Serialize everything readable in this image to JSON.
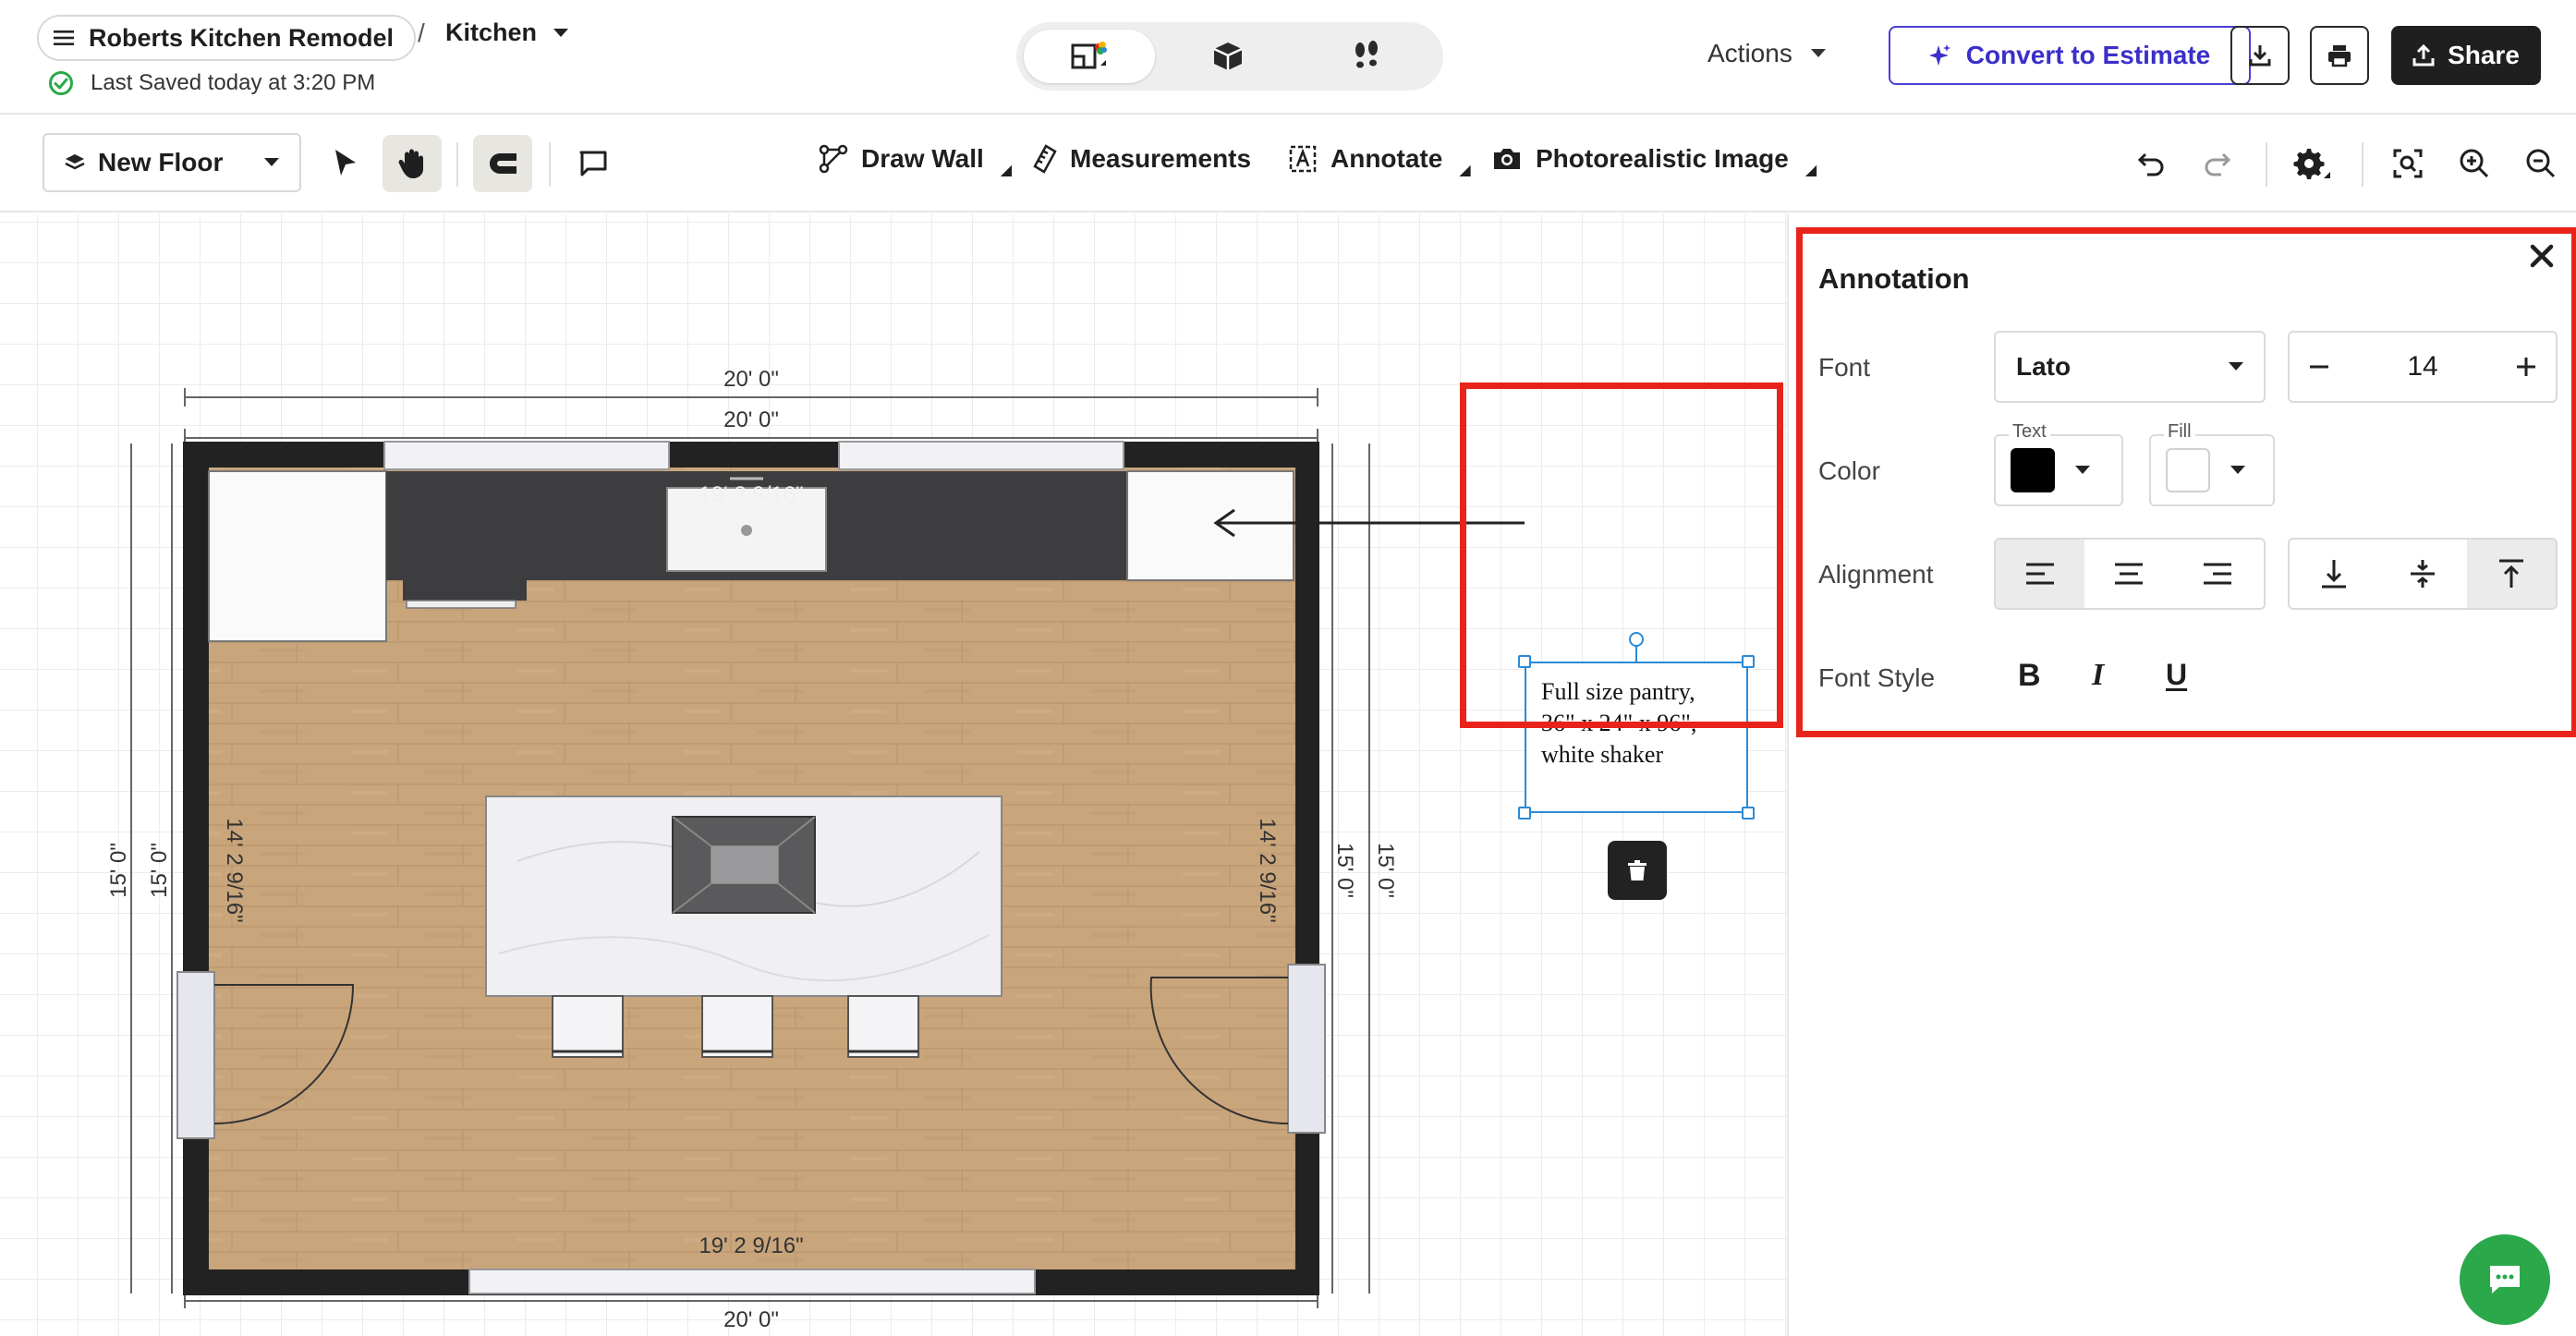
{
  "header": {
    "project_name": "Roberts Kitchen Remodel",
    "breadcrumb_separator": "/",
    "room_name": "Kitchen",
    "saved_status": "Last Saved today at 3:20 PM",
    "actions_label": "Actions",
    "convert_label": "Convert to Estimate",
    "share_label": "Share",
    "view_modes": [
      "floor-plan-2d",
      "3d-view",
      "walkthrough"
    ],
    "active_view_mode": "floor-plan-2d"
  },
  "toolbar": {
    "floor_label": "New Floor",
    "draw_wall_label": "Draw Wall",
    "measurements_label": "Measurements",
    "annotate_label": "Annotate",
    "photorealistic_label": "Photorealistic Image"
  },
  "canvas": {
    "dimensions": {
      "top_outer": "20' 0\"",
      "top_inner": "20' 0\"",
      "bottom_outer": "20' 0\"",
      "top_interior": "19' 2 9/16\"",
      "bottom_interior": "19' 2 9/16\"",
      "left_outer": "15' 0\"",
      "left_inner": "15' 0\"",
      "left_interior": "14' 2 9/16\"",
      "right_interior": "14' 2 9/16\"",
      "right_inner": "15' 0\"",
      "right_outer": "15' 0\""
    },
    "annotation": {
      "line1": "Full size pantry,",
      "line2": "36\" x 24\" x 96\",",
      "line3": "white shaker"
    }
  },
  "panel": {
    "title": "Annotation",
    "font_label": "Font",
    "font_value": "Lato",
    "font_size": "14",
    "color_label": "Color",
    "text_color_label": "Text",
    "text_color": "#000000",
    "fill_color_label": "Fill",
    "fill_color": "#ffffff",
    "alignment_label": "Alignment",
    "horizontal_alignment": "left",
    "vertical_alignment": "top",
    "font_style_label": "Font Style",
    "bold_glyph": "B",
    "italic_glyph": "I",
    "underline_glyph": "U"
  },
  "colors": {
    "accent": "#3b2fc9",
    "highlight": "#e8241a",
    "selection": "#2b8ad6",
    "chat": "#2aa84a"
  }
}
